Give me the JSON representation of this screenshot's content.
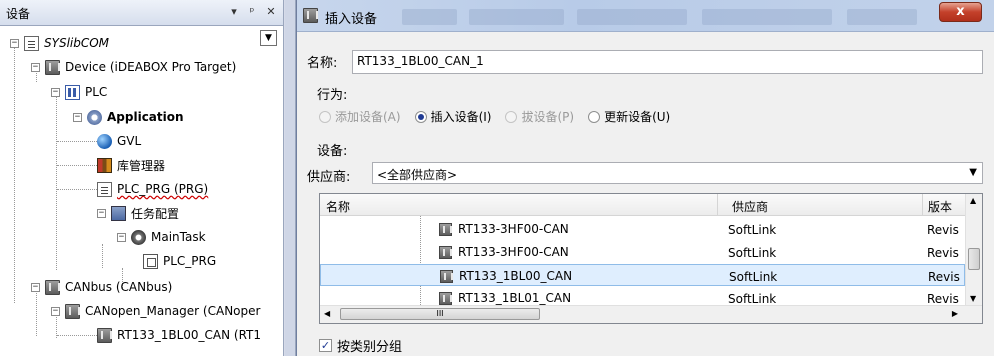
{
  "devices_panel": {
    "title": "设备",
    "dropdown_icon": "chevron-down-icon",
    "pin_icon": "pin-icon",
    "close_icon": "close-icon",
    "tree": {
      "root": "SYSlibCOM",
      "device": "Device (iDEABOX Pro Target)",
      "plc": "PLC",
      "application": "Application",
      "gvl": "GVL",
      "library_manager": "库管理器",
      "plc_prg": "PLC_PRG (PRG)",
      "task_config": "任务配置",
      "main_task": "MainTask",
      "main_task_prg": "PLC_PRG",
      "canbus": "CANbus (CANbus)",
      "canopen_manager": "CANopen_Manager (CANoper",
      "slave": "RT133_1BL00_CAN (RT1"
    }
  },
  "dialog": {
    "title": "插入设备",
    "close_label": "x",
    "name_label": "名称:",
    "name_value": "RT133_1BL00_CAN_1",
    "action_label": "行为:",
    "actions": [
      {
        "label": "添加设备(A)",
        "state": "disabled"
      },
      {
        "label": "插入设备(I)",
        "state": "selected"
      },
      {
        "label": "拔设备(P)",
        "state": "disabled"
      },
      {
        "label": "更新设备(U)",
        "state": "normal"
      }
    ],
    "devices_label": "设备:",
    "vendor_label": "供应商:",
    "vendor_value": "<全部供应商>",
    "list": {
      "columns": [
        "名称",
        "供应商",
        "版本"
      ],
      "rows": [
        {
          "name": "RT133-3HF00-CAN",
          "vendor": "SoftLink",
          "version": "Revis",
          "selected": false
        },
        {
          "name": "RT133-3HF00-CAN",
          "vendor": "SoftLink",
          "version": "Revis",
          "selected": false
        },
        {
          "name": "RT133_1BL00_CAN",
          "vendor": "SoftLink",
          "version": "Revis",
          "selected": true
        },
        {
          "name": "RT133_1BL01_CAN",
          "vendor": "SoftLink",
          "version": "Revis",
          "selected": false
        }
      ],
      "hscroll_grip": "III"
    },
    "group_by_category_label": "按类别分组",
    "group_by_category_checked": true
  }
}
